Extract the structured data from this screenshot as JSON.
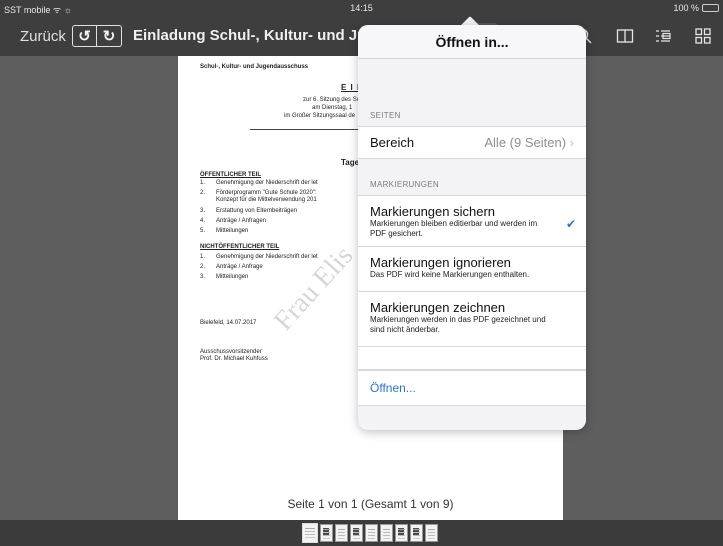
{
  "status_bar": {
    "carrier": "SST mobile ᯤ ☼",
    "time": "14:15",
    "battery": "100 %",
    "battery_level": 1.0,
    "battery_color": "#58d14a"
  },
  "toolbar": {
    "back_label": "Zurück",
    "undo_glyph": "↺",
    "redo_glyph": "↻",
    "title": "Einladung Schul-, Kultur- und Jugendausschuss 19.09....",
    "icons": [
      "share-icon",
      "comment-icon",
      "annotate-icon",
      "search-icon",
      "book-icon",
      "outline-icon",
      "grid-icon"
    ]
  },
  "document": {
    "header_left": "Schul-, Kultur- und Jugendausschuss",
    "heading": "E I N I",
    "intro": [
      "zur 6. Sitzung des Schul-",
      "am Dienstag, 1",
      "im Großer Sitzungssaal de"
    ],
    "agenda_heading": "Tage",
    "public_title": "ÖFFENTLICHER TEIL",
    "public_items": [
      {
        "num": "1.",
        "text": "Genehmigung der Niederschrift der let"
      },
      {
        "num": "2.",
        "text": "Förderprogramm \"Gute Schule 2020\":"
      },
      {
        "num": "",
        "text": "Konzept für die Mittelverwendung 201"
      },
      {
        "num": "3.",
        "text": "Erstattung von Elternbeiträgen"
      },
      {
        "num": "4.",
        "text": "Anträge / Anfragen"
      },
      {
        "num": "5.",
        "text": "Mitteilungen"
      }
    ],
    "private_title": "NICHTÖFFENTLICHER TEIL",
    "private_items": [
      {
        "num": "1.",
        "text": "Genehmigung der Niederschrift der let"
      },
      {
        "num": "2.",
        "text": "Anträge / Anfrage"
      },
      {
        "num": "3.",
        "text": "Mitteilungen"
      }
    ],
    "place_date": "Bielefeld, 14.07.2017",
    "signature_role": "Ausschussvorsitzender",
    "signature_name": "Prof. Dr. Michael Kuhfuss",
    "watermark": "Frau Elis"
  },
  "page_indicator": "Seite 1 von 1 (Gesamt 1 von 9)",
  "popover": {
    "title": "Öffnen in...",
    "section_pages": "SEITEN",
    "range_label": "Bereich",
    "range_value": "Alle (9 Seiten)",
    "section_markings": "MARKIERUNGEN",
    "options": [
      {
        "title": "Markierungen sichern",
        "desc": "Markierungen bleiben editierbar und werden im PDF gesichert.",
        "selected": true
      },
      {
        "title": "Markierungen ignorieren",
        "desc": "Das PDF wird keine Markierungen enthalten.",
        "selected": false
      },
      {
        "title": "Markierungen zeichnen",
        "desc": "Markierungen werden in das PDF gezeichnet und sind nicht änderbar.",
        "selected": false
      }
    ],
    "open_label": "Öffnen...",
    "accent": "#2a72d8"
  },
  "thumbnails": {
    "count": 9,
    "active_index": 0
  }
}
